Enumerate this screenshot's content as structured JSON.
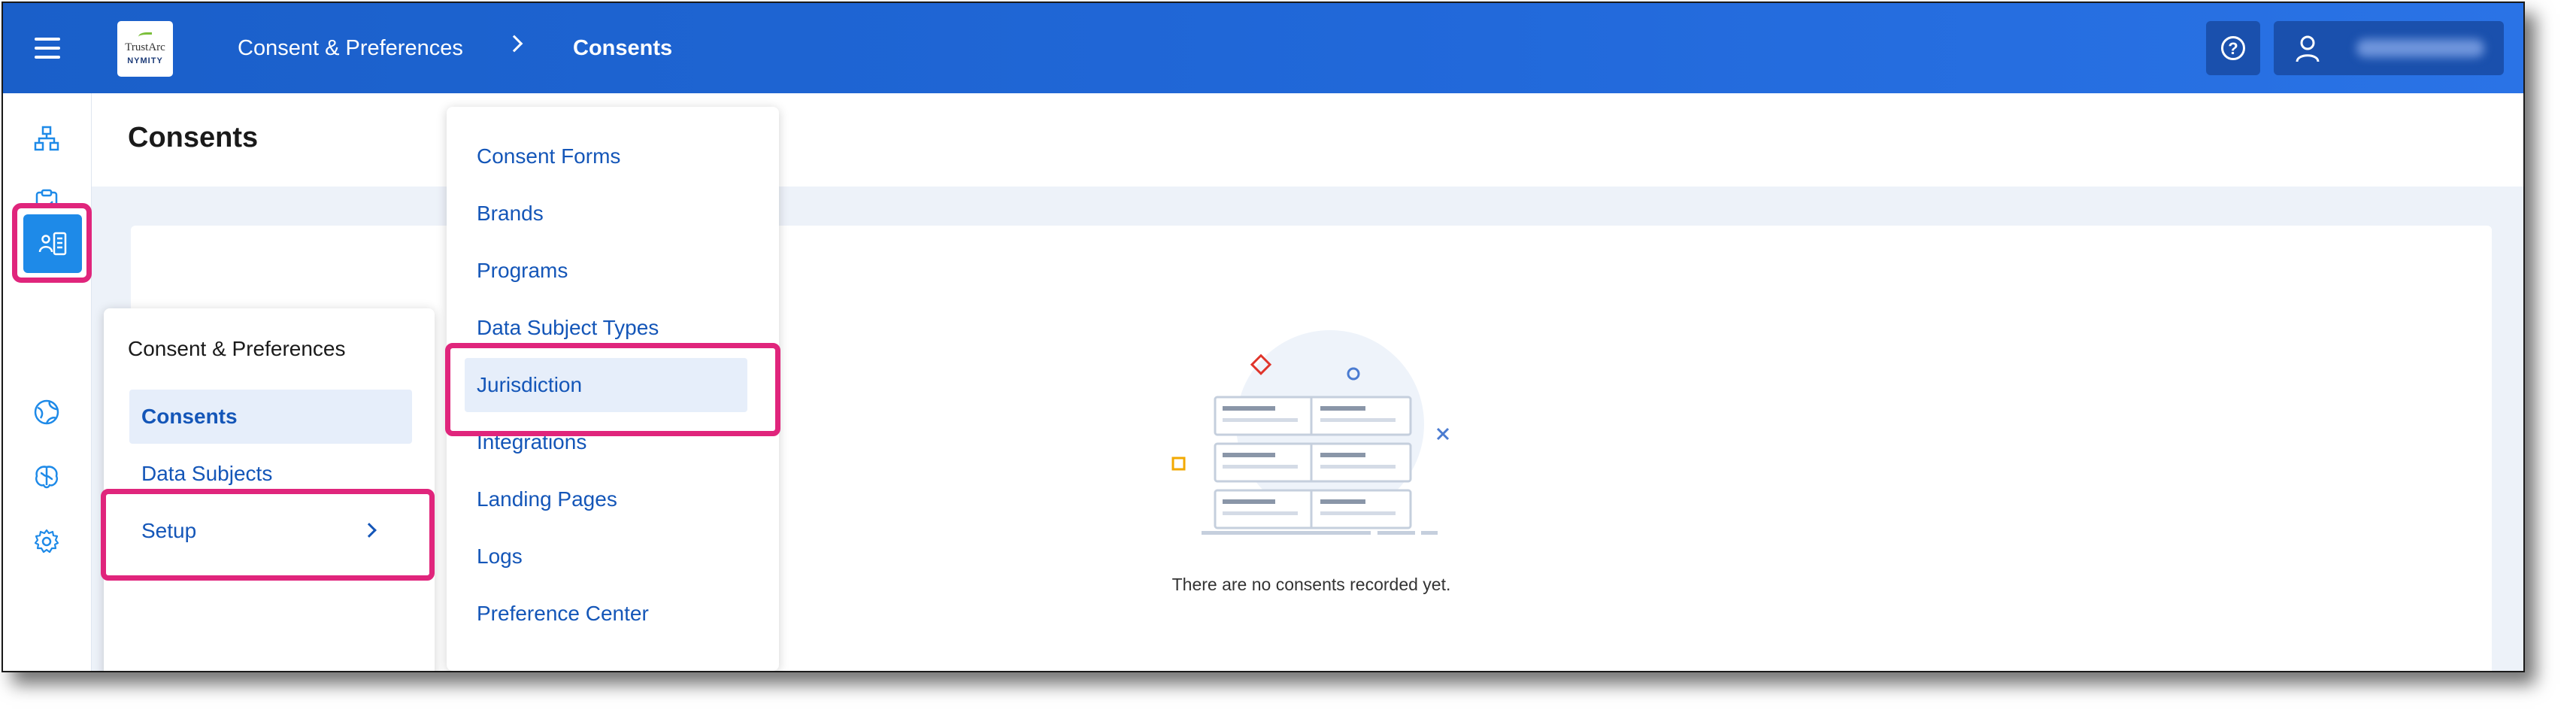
{
  "topbar": {
    "logo_line1": "TrustArc",
    "logo_line2": "NYMITY",
    "breadcrumb": [
      "Consent & Preferences",
      "Consents"
    ],
    "accent": "#2168d9"
  },
  "rail": {
    "icons": [
      "hierarchy-icon",
      "clipboard-check-icon",
      "monitor-user-icon",
      "consent-icon",
      "globe-icon",
      "brain-icon",
      "gear-icon"
    ],
    "active_index": 3,
    "active_color": "#1e8ae8"
  },
  "page": {
    "title": "Consents",
    "empty_message": "There are no consents recorded yet."
  },
  "menu": {
    "title": "Consent & Preferences",
    "items": [
      {
        "label": "Consents",
        "selected": true
      },
      {
        "label": "Data Subjects",
        "selected": false
      },
      {
        "label": "Setup",
        "selected": false
      }
    ]
  },
  "setup_menu": {
    "items": [
      {
        "label": "Consent Forms"
      },
      {
        "label": "Brands"
      },
      {
        "label": "Programs"
      },
      {
        "label": "Data Subject Types"
      },
      {
        "label": "Jurisdiction"
      },
      {
        "label": "Integrations"
      },
      {
        "label": "Landing Pages"
      },
      {
        "label": "Logs"
      },
      {
        "label": "Preference Center"
      }
    ]
  },
  "highlight_color": "#e0257c"
}
